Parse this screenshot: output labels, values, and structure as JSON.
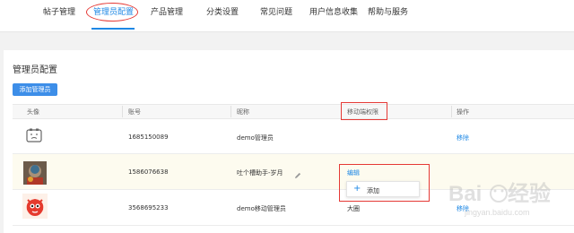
{
  "nav": {
    "items": [
      {
        "label": "帖子管理"
      },
      {
        "label": "管理员配置"
      },
      {
        "label": "产品管理"
      },
      {
        "label": "分类设置"
      },
      {
        "label": "常见问题"
      },
      {
        "label": "用户信息收集"
      },
      {
        "label": "帮助与服务"
      }
    ],
    "active_index": 1
  },
  "page": {
    "title": "管理员配置",
    "add_button": "添加管理员"
  },
  "table": {
    "headers": [
      "头像",
      "账号",
      "昵称",
      "移动端权限",
      "操作"
    ],
    "rows": [
      {
        "avatar": "placeholder-face-icon",
        "account": "1685150089",
        "nickname": "demo管理员",
        "mobile_permission": "",
        "action": "移除"
      },
      {
        "avatar": "dark-photo-avatar",
        "account": "1586076638",
        "nickname": "吐个槽助手-岁月",
        "mobile_permission": "编辑",
        "action": ""
      },
      {
        "avatar": "red-mascot-avatar",
        "account": "3568695233",
        "nickname": "demo移动管理员",
        "mobile_permission": "大圈",
        "action": "移除"
      }
    ]
  },
  "dropdown": {
    "add_label": "添加",
    "icon": "plus-icon"
  },
  "watermark": {
    "text": "Baidu经验",
    "url": "jingyan.baidu.com"
  },
  "colors": {
    "accent": "#1e88e5",
    "annotation": "#e53935",
    "button": "#3d8ee8"
  }
}
